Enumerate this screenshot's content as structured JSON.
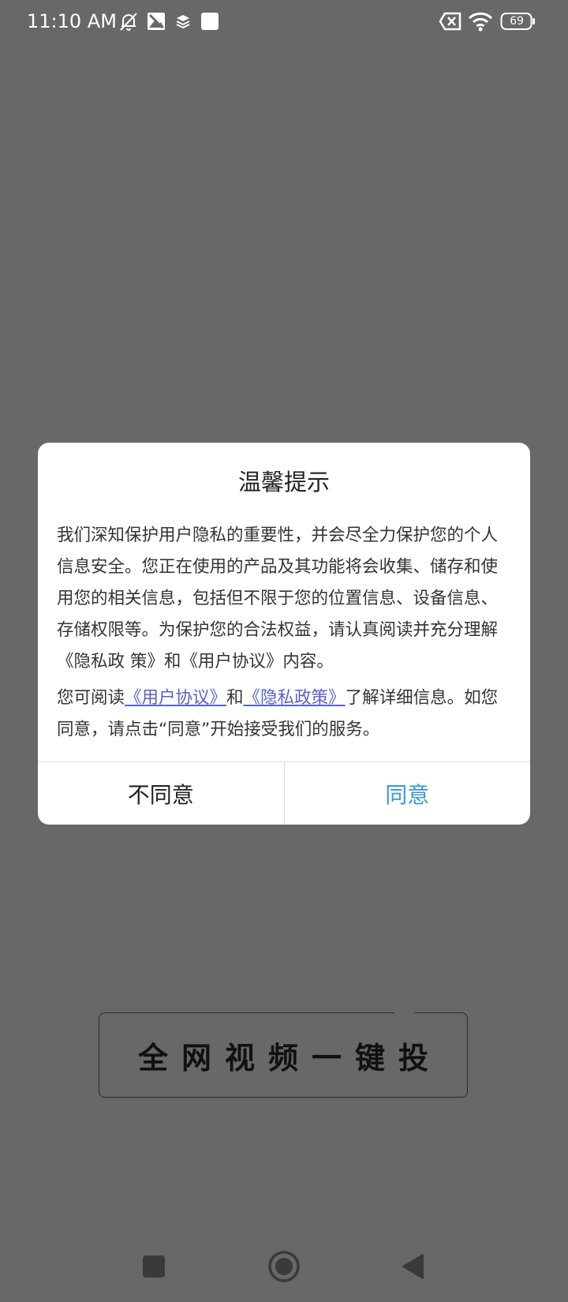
{
  "status_bar": {
    "time": "11:10 AM",
    "battery_level": "69",
    "icons": [
      "bell-off-icon",
      "image-icon",
      "layers-icon",
      "square-icon",
      "sim-off-icon",
      "wifi-icon",
      "battery-icon"
    ]
  },
  "dialog": {
    "title": "温馨提示",
    "paragraph1": "我们深知保护用户隐私的重要性，并会尽全力保护您的个人信息安全。您正在使用的产品及其功能将会收集、储存和使用您的相关信息，包括但不限于您的位置信息、设备信息、存储权限等。为保护您的合法权益，请认真阅读并充分理解《隐私政 策》和《用户协议》内容。",
    "paragraph2_prefix": "您可阅读",
    "user_agreement_link": "《用户协议》",
    "paragraph2_and": "和",
    "privacy_policy_link": "《隐私政策》",
    "paragraph2_suffix": "了解详细信息。如您同意，请点击“同意”开始接受我们的服务。",
    "disagree_label": "不同意",
    "agree_label": "同意"
  },
  "background": {
    "banner_text": "全网视频一键投"
  },
  "nav_bar": {
    "icons": [
      "recents-square-icon",
      "home-circle-icon",
      "back-triangle-icon"
    ]
  },
  "colors": {
    "overlay": "#686868",
    "agree": "#3a97d4",
    "link": "#5663c8"
  }
}
